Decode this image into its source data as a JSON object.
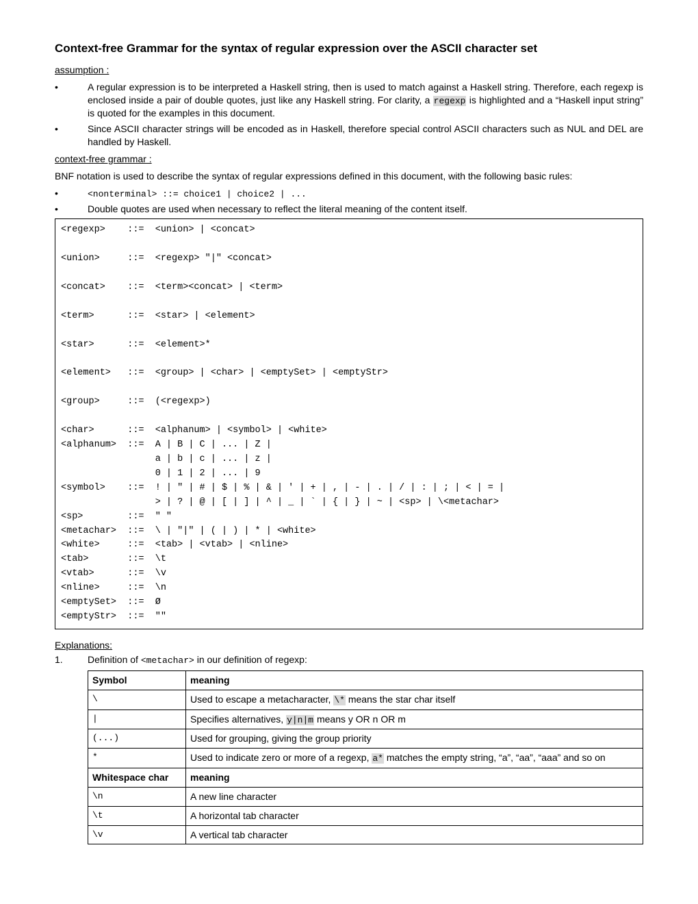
{
  "title": "Context-free Grammar for the syntax of regular expression over the ASCII character set",
  "assumption_heading": "assumption :",
  "assump1_a": "A regular expression is to be interpreted a Haskell string, then is used to match against a Haskell string. Therefore, each regexp is enclosed inside a pair of double quotes, just like any Haskell string. For clarity, a ",
  "assump1_code": "regexp",
  "assump1_b": " is highlighted and a “Haskell input string” is quoted for the examples in this document.",
  "assump2": "Since ASCII character strings will be encoded as in Haskell, therefore special control ASCII characters such as NUL and DEL are handled by Haskell.",
  "cfg_heading": "context-free grammar :",
  "cfg_intro": "BNF notation is used to describe the syntax of regular expressions defined in this document, with the following basic rules:",
  "rule1": "<nonterminal> ::= choice1 | choice2 | ...",
  "rule2": "Double quotes are used when necessary to reflect the literal meaning of the content itself.",
  "grammar": "<regexp>    ::=  <union> | <concat>\n\n<union>     ::=  <regexp> \"|\" <concat>\n\n<concat>    ::=  <term><concat> | <term>\n\n<term>      ::=  <star> | <element>\n\n<star>      ::=  <element>*\n\n<element>   ::=  <group> | <char> | <emptySet> | <emptyStr>\n\n<group>     ::=  (<regexp>)\n\n<char>      ::=  <alphanum> | <symbol> | <white>\n<alphanum>  ::=  A | B | C | ... | Z |\n                 a | b | c | ... | z |\n                 0 | 1 | 2 | ... | 9\n<symbol>    ::=  ! | \" | # | $ | % | & | ' | + | , | - | . | / | : | ; | < | = |\n                 > | ? | @ | [ | ] | ^ | _ | ` | { | } | ~ | <sp> | \\<metachar>\n<sp>        ::=  \" \"\n<metachar>  ::=  \\ | \"|\" | ( | ) | * | <white>\n<white>     ::=  <tab> | <vtab> | <nline>\n<tab>       ::=  \\t\n<vtab>      ::=  \\v\n<nline>     ::=  \\n\n<emptySet>  ::=  Ø\n<emptyStr>  ::=  \"\"",
  "explanations_heading": "Explanations:",
  "expl1_a": "Definition of ",
  "expl1_code": "<metachar>",
  "expl1_b": " in our definition of regexp:",
  "table": {
    "h1": "Symbol",
    "h2": "meaning",
    "r1s": "\\",
    "r1m_a": "Used to escape a metacharacter, ",
    "r1m_code": "\\*",
    "r1m_b": " means the star char itself",
    "r2s": "|",
    "r2m_a": "Specifies alternatives, ",
    "r2m_code": "y|n|m",
    "r2m_b": " means y OR n OR m",
    "r3s": "(...)",
    "r3m": "Used for grouping, giving the group priority",
    "r4s": "*",
    "r4m_a": "Used to indicate zero or more of a regexp, ",
    "r4m_code": "a*",
    "r4m_b": " matches the empty string, “a”, “aa”, “aaa” and so on",
    "h3": "Whitespace char",
    "h4": "meaning",
    "r5s": "\\n",
    "r5m": "A new line character",
    "r6s": "\\t",
    "r6m": "A horizontal tab character",
    "r7s": "\\v",
    "r7m": "A vertical tab character"
  }
}
